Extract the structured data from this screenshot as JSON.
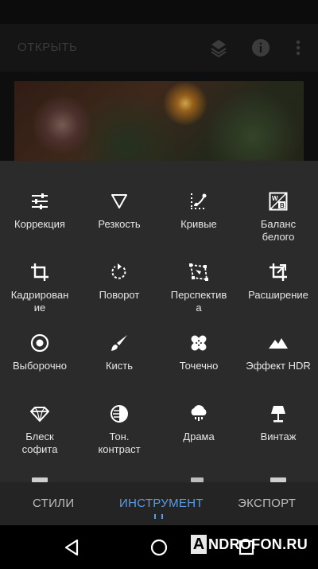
{
  "app_bar": {
    "open_label": "ОТКРЫТЬ",
    "icons": [
      "layers-icon",
      "info-icon",
      "more-vert-icon"
    ]
  },
  "tools": [
    {
      "label": "Коррекция",
      "icon": "sliders-icon"
    },
    {
      "label": "Резкость",
      "icon": "triangle-icon"
    },
    {
      "label": "Кривые",
      "icon": "curves-icon"
    },
    {
      "label": "Баланс\nбелого",
      "icon": "white-balance-icon"
    },
    {
      "label": "Кадрирован\nие",
      "icon": "crop-icon"
    },
    {
      "label": "Поворот",
      "icon": "rotate-icon"
    },
    {
      "label": "Перспектив\nа",
      "icon": "perspective-icon"
    },
    {
      "label": "Расширение",
      "icon": "expand-icon"
    },
    {
      "label": "Выборочно",
      "icon": "selective-icon"
    },
    {
      "label": "Кисть",
      "icon": "brush-icon"
    },
    {
      "label": "Точечно",
      "icon": "healing-icon"
    },
    {
      "label": "Эффект HDR",
      "icon": "mountains-icon"
    },
    {
      "label": "Блеск\nсофита",
      "icon": "diamond-icon"
    },
    {
      "label": "Тон.\nконтраст",
      "icon": "tonal-contrast-icon"
    },
    {
      "label": "Драма",
      "icon": "cloud-icon"
    },
    {
      "label": "Винтаж",
      "icon": "lamp-icon"
    }
  ],
  "tabs": [
    {
      "label": "СТИЛИ",
      "active": false
    },
    {
      "label": "ИНСТРУМЕНТ",
      "active": true
    },
    {
      "label": "ЭКСПОРТ",
      "active": false
    }
  ],
  "nav": [
    "back-icon",
    "home-icon",
    "recents-icon"
  ],
  "watermark": {
    "letter": "A",
    "text": "NDROFON.RU"
  },
  "colors": {
    "accent": "#5b9be0",
    "sheet": "#2b2b2b",
    "tabbar": "#242424"
  }
}
